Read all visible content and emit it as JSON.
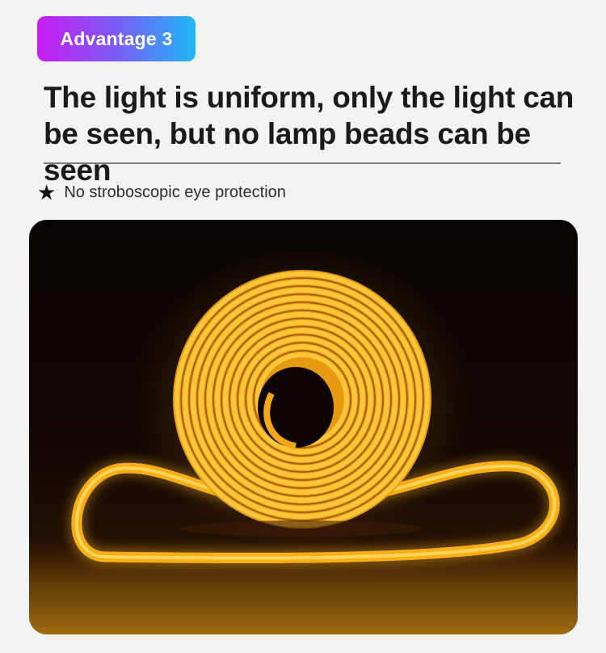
{
  "badge": {
    "label": "Advantage 3"
  },
  "headline": {
    "line1": "The light is uniform, only the light can",
    "line2": "be seen, but no lamp beads can be seen"
  },
  "feature": {
    "icon": "star-icon",
    "text": "No stroboscopic eye protection"
  },
  "photo": {
    "subject": "coiled amber LED neon light strip glowing on a dark surface"
  },
  "colors": {
    "badge_gradient_start": "#c81cf0",
    "badge_gradient_end": "#1fb8f5",
    "headline": "#1a1a1a",
    "glow": "#f6b81a",
    "background": "#f3f3f3"
  }
}
